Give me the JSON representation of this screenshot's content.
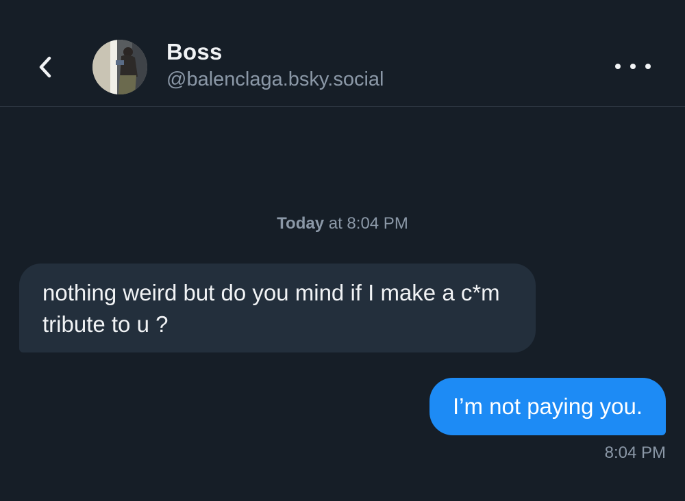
{
  "header": {
    "title": "Boss",
    "handle": "@balenclaga.bsky.social",
    "back_icon": "chevron-left-icon",
    "more_icon": "ellipsis-horizontal-icon"
  },
  "conversation": {
    "divider": {
      "day": "Today",
      "rest": " at 8:04 PM"
    },
    "messages": [
      {
        "direction": "incoming",
        "text": "nothing weird but do you mind if I make a c*m tribute to u ?"
      },
      {
        "direction": "outgoing",
        "text": "I’m not paying you.",
        "time": "8:04 PM"
      }
    ]
  },
  "colors": {
    "background": "#161e27",
    "incoming_bubble": "#232f3c",
    "outgoing_bubble": "#1d8bf5",
    "muted_text": "#8b98a7"
  }
}
